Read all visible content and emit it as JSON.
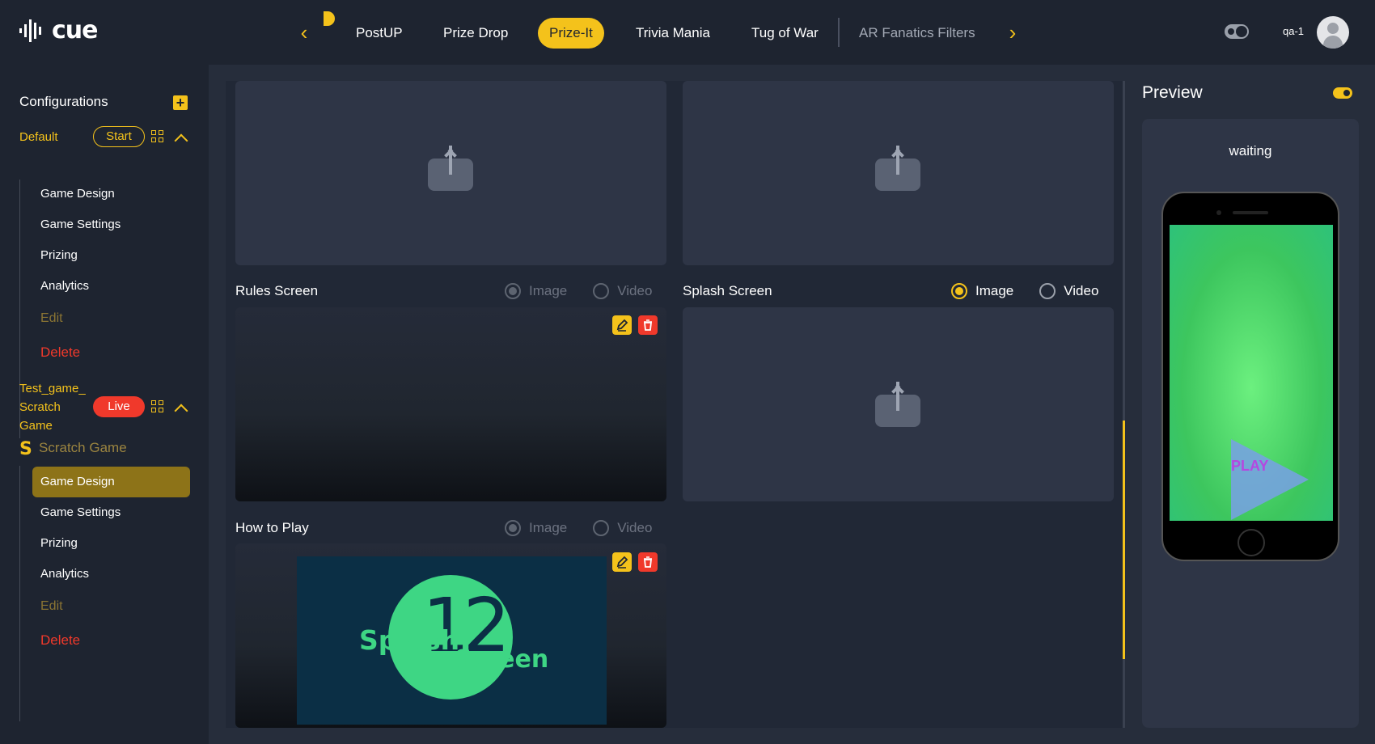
{
  "app": {
    "logo_text": "cue"
  },
  "nav": {
    "tabs": [
      {
        "label": "PostUP"
      },
      {
        "label": "Prize Drop"
      },
      {
        "label": "Prize-It"
      },
      {
        "label": "Trivia Mania"
      },
      {
        "label": "Tug of War"
      },
      {
        "label": "AR Fanatics Filters"
      }
    ],
    "prev_icon": "chevron-left-icon",
    "next_icon": "chevron-right-icon"
  },
  "user": {
    "name": "qa-1"
  },
  "sidebar": {
    "title": "Configurations",
    "add_icon": "plus-icon",
    "configs": [
      {
        "name": "Default",
        "status": "Start",
        "items": [
          {
            "label": "Game Design"
          },
          {
            "label": "Game Settings"
          },
          {
            "label": "Prizing"
          },
          {
            "label": "Analytics"
          },
          {
            "label": "Edit"
          },
          {
            "label": "Delete"
          }
        ]
      },
      {
        "name_lines": [
          "Test_game_",
          "Scratch",
          "Game"
        ],
        "status": "Live",
        "game_type": "Scratch Game",
        "items": [
          {
            "label": "Game Design"
          },
          {
            "label": "Game Settings"
          },
          {
            "label": "Prizing"
          },
          {
            "label": "Analytics"
          },
          {
            "label": "Edit"
          },
          {
            "label": "Delete"
          }
        ]
      }
    ]
  },
  "sections": {
    "rules": {
      "label": "Rules Screen",
      "option_image": "Image",
      "option_video": "Video"
    },
    "splash": {
      "label": "Splash Screen",
      "option_image": "Image",
      "option_video": "Video"
    },
    "howto": {
      "label": "How to Play",
      "option_image": "Image",
      "option_video": "Video",
      "image_text_1": "Splash",
      "image_text_2": "Screen",
      "image_number": "12"
    }
  },
  "preview": {
    "title": "Preview",
    "status": "waiting",
    "play_label": "PLAY"
  },
  "colors": {
    "accent": "#f4c21b",
    "danger": "#f0392b",
    "background": "#1e2430"
  }
}
